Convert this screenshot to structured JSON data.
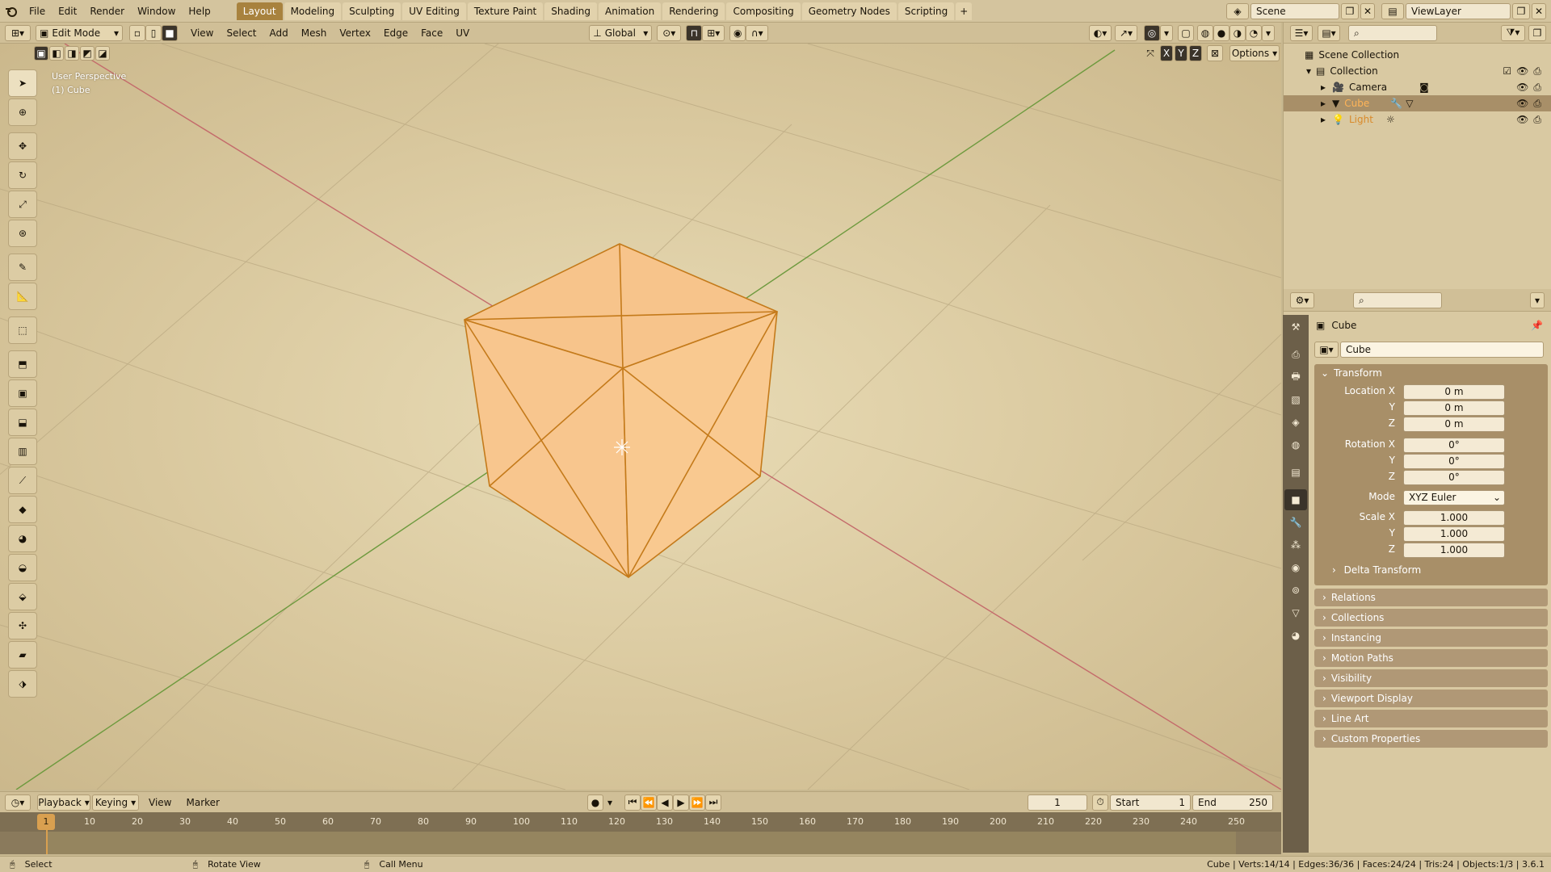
{
  "topbar": {
    "menus": [
      "File",
      "Edit",
      "Render",
      "Window",
      "Help"
    ],
    "workspaces": [
      "Layout",
      "Modeling",
      "Sculpting",
      "UV Editing",
      "Texture Paint",
      "Shading",
      "Animation",
      "Rendering",
      "Compositing",
      "Geometry Nodes",
      "Scripting"
    ],
    "active_workspace": "Layout",
    "add_tab": "+",
    "scene": "Scene",
    "view_layer": "ViewLayer"
  },
  "viewport_header": {
    "mode": "Edit Mode",
    "menus": [
      "View",
      "Select",
      "Add",
      "Mesh",
      "Vertex",
      "Edge",
      "Face",
      "UV"
    ],
    "orientation": "Global",
    "axes": [
      "X",
      "Y",
      "Z"
    ],
    "options": "Options"
  },
  "viewport": {
    "perspective": "User Perspective",
    "object_label": "(1) Cube"
  },
  "outliner": {
    "root": "Scene Collection",
    "collection": "Collection",
    "items": [
      {
        "name": "Camera",
        "selected": false
      },
      {
        "name": "Cube",
        "selected": true
      },
      {
        "name": "Light",
        "selected": false
      }
    ]
  },
  "properties": {
    "object_name": "Cube",
    "datablock_name": "Cube",
    "transform_title": "Transform",
    "location_label": "Location X",
    "location": [
      "0 m",
      "0 m",
      "0 m"
    ],
    "rotation_label": "Rotation X",
    "rotation": [
      "0°",
      "0°",
      "0°"
    ],
    "y_label": "Y",
    "z_label": "Z",
    "mode_label": "Mode",
    "mode_value": "XYZ Euler",
    "scale_label": "Scale X",
    "scale": [
      "1.000",
      "1.000",
      "1.000"
    ],
    "delta": "Delta Transform",
    "panels": [
      "Relations",
      "Collections",
      "Instancing",
      "Motion Paths",
      "Visibility",
      "Viewport Display",
      "Line Art",
      "Custom Properties"
    ]
  },
  "timeline": {
    "menus": [
      "Playback",
      "Keying",
      "View",
      "Marker"
    ],
    "current_frame": "1",
    "start_label": "Start",
    "start": "1",
    "end_label": "End",
    "end": "250",
    "ticks": [
      "10",
      "20",
      "30",
      "40",
      "50",
      "60",
      "70",
      "80",
      "90",
      "100",
      "110",
      "120",
      "130",
      "140",
      "150",
      "160",
      "170",
      "180",
      "190",
      "200",
      "210",
      "220",
      "230",
      "240",
      "250"
    ]
  },
  "status": {
    "select": "Select",
    "rotate": "Rotate View",
    "call_menu": "Call Menu",
    "stats": "Cube | Verts:14/14 | Edges:36/36 | Faces:24/24 | Tris:24 | Objects:1/3 | 3.6.1"
  },
  "colors": {
    "accent": "#a8823e",
    "selection": "#ffcc8f",
    "edge": "#c47a1a"
  }
}
